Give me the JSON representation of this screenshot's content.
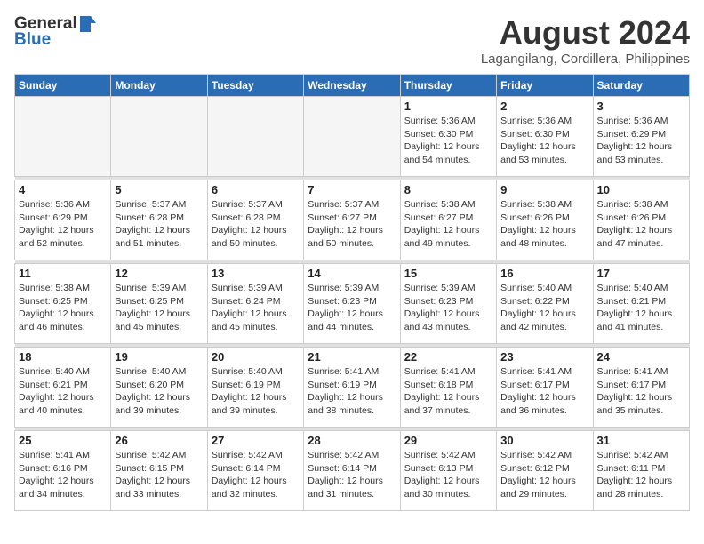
{
  "header": {
    "logo_general": "General",
    "logo_blue": "Blue",
    "title": "August 2024",
    "subtitle": "Lagangilang, Cordillera, Philippines"
  },
  "days_of_week": [
    "Sunday",
    "Monday",
    "Tuesday",
    "Wednesday",
    "Thursday",
    "Friday",
    "Saturday"
  ],
  "weeks": [
    [
      {
        "day": "",
        "info": ""
      },
      {
        "day": "",
        "info": ""
      },
      {
        "day": "",
        "info": ""
      },
      {
        "day": "",
        "info": ""
      },
      {
        "day": "1",
        "info": "Sunrise: 5:36 AM\nSunset: 6:30 PM\nDaylight: 12 hours\nand 54 minutes."
      },
      {
        "day": "2",
        "info": "Sunrise: 5:36 AM\nSunset: 6:30 PM\nDaylight: 12 hours\nand 53 minutes."
      },
      {
        "day": "3",
        "info": "Sunrise: 5:36 AM\nSunset: 6:29 PM\nDaylight: 12 hours\nand 53 minutes."
      }
    ],
    [
      {
        "day": "4",
        "info": "Sunrise: 5:36 AM\nSunset: 6:29 PM\nDaylight: 12 hours\nand 52 minutes."
      },
      {
        "day": "5",
        "info": "Sunrise: 5:37 AM\nSunset: 6:28 PM\nDaylight: 12 hours\nand 51 minutes."
      },
      {
        "day": "6",
        "info": "Sunrise: 5:37 AM\nSunset: 6:28 PM\nDaylight: 12 hours\nand 50 minutes."
      },
      {
        "day": "7",
        "info": "Sunrise: 5:37 AM\nSunset: 6:27 PM\nDaylight: 12 hours\nand 50 minutes."
      },
      {
        "day": "8",
        "info": "Sunrise: 5:38 AM\nSunset: 6:27 PM\nDaylight: 12 hours\nand 49 minutes."
      },
      {
        "day": "9",
        "info": "Sunrise: 5:38 AM\nSunset: 6:26 PM\nDaylight: 12 hours\nand 48 minutes."
      },
      {
        "day": "10",
        "info": "Sunrise: 5:38 AM\nSunset: 6:26 PM\nDaylight: 12 hours\nand 47 minutes."
      }
    ],
    [
      {
        "day": "11",
        "info": "Sunrise: 5:38 AM\nSunset: 6:25 PM\nDaylight: 12 hours\nand 46 minutes."
      },
      {
        "day": "12",
        "info": "Sunrise: 5:39 AM\nSunset: 6:25 PM\nDaylight: 12 hours\nand 45 minutes."
      },
      {
        "day": "13",
        "info": "Sunrise: 5:39 AM\nSunset: 6:24 PM\nDaylight: 12 hours\nand 45 minutes."
      },
      {
        "day": "14",
        "info": "Sunrise: 5:39 AM\nSunset: 6:23 PM\nDaylight: 12 hours\nand 44 minutes."
      },
      {
        "day": "15",
        "info": "Sunrise: 5:39 AM\nSunset: 6:23 PM\nDaylight: 12 hours\nand 43 minutes."
      },
      {
        "day": "16",
        "info": "Sunrise: 5:40 AM\nSunset: 6:22 PM\nDaylight: 12 hours\nand 42 minutes."
      },
      {
        "day": "17",
        "info": "Sunrise: 5:40 AM\nSunset: 6:21 PM\nDaylight: 12 hours\nand 41 minutes."
      }
    ],
    [
      {
        "day": "18",
        "info": "Sunrise: 5:40 AM\nSunset: 6:21 PM\nDaylight: 12 hours\nand 40 minutes."
      },
      {
        "day": "19",
        "info": "Sunrise: 5:40 AM\nSunset: 6:20 PM\nDaylight: 12 hours\nand 39 minutes."
      },
      {
        "day": "20",
        "info": "Sunrise: 5:40 AM\nSunset: 6:19 PM\nDaylight: 12 hours\nand 39 minutes."
      },
      {
        "day": "21",
        "info": "Sunrise: 5:41 AM\nSunset: 6:19 PM\nDaylight: 12 hours\nand 38 minutes."
      },
      {
        "day": "22",
        "info": "Sunrise: 5:41 AM\nSunset: 6:18 PM\nDaylight: 12 hours\nand 37 minutes."
      },
      {
        "day": "23",
        "info": "Sunrise: 5:41 AM\nSunset: 6:17 PM\nDaylight: 12 hours\nand 36 minutes."
      },
      {
        "day": "24",
        "info": "Sunrise: 5:41 AM\nSunset: 6:17 PM\nDaylight: 12 hours\nand 35 minutes."
      }
    ],
    [
      {
        "day": "25",
        "info": "Sunrise: 5:41 AM\nSunset: 6:16 PM\nDaylight: 12 hours\nand 34 minutes."
      },
      {
        "day": "26",
        "info": "Sunrise: 5:42 AM\nSunset: 6:15 PM\nDaylight: 12 hours\nand 33 minutes."
      },
      {
        "day": "27",
        "info": "Sunrise: 5:42 AM\nSunset: 6:14 PM\nDaylight: 12 hours\nand 32 minutes."
      },
      {
        "day": "28",
        "info": "Sunrise: 5:42 AM\nSunset: 6:14 PM\nDaylight: 12 hours\nand 31 minutes."
      },
      {
        "day": "29",
        "info": "Sunrise: 5:42 AM\nSunset: 6:13 PM\nDaylight: 12 hours\nand 30 minutes."
      },
      {
        "day": "30",
        "info": "Sunrise: 5:42 AM\nSunset: 6:12 PM\nDaylight: 12 hours\nand 29 minutes."
      },
      {
        "day": "31",
        "info": "Sunrise: 5:42 AM\nSunset: 6:11 PM\nDaylight: 12 hours\nand 28 minutes."
      }
    ]
  ]
}
